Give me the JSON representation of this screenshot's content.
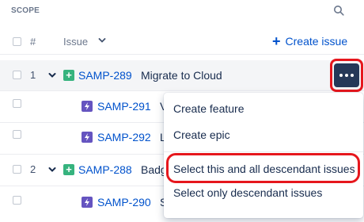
{
  "panel": {
    "title": "SCOPE",
    "search_icon": "search-icon"
  },
  "columns": {
    "hash": "#",
    "issue": "Issue",
    "create_issue": "Create issue"
  },
  "rows": [
    {
      "number": "1",
      "key": "SAMP-289",
      "summary": "Migrate to Cloud",
      "type": "epic"
    },
    {
      "key": "SAMP-291",
      "summary": "V",
      "type": "feature"
    },
    {
      "key": "SAMP-292",
      "summary": "L",
      "type": "feature"
    },
    {
      "number": "2",
      "key": "SAMP-288",
      "summary": "Badg",
      "type": "epic"
    },
    {
      "key": "SAMP-290",
      "summary": "S",
      "type": "feature"
    }
  ],
  "menu": {
    "items": [
      "Create feature",
      "Create epic",
      "Select this and all descendant issues",
      "Select only descendant issues"
    ]
  },
  "colors": {
    "accent": "#0052cc",
    "highlight_outline": "#e6171d",
    "epic": "#36b37e",
    "feature": "#6554c0",
    "more_button": "#253858"
  }
}
